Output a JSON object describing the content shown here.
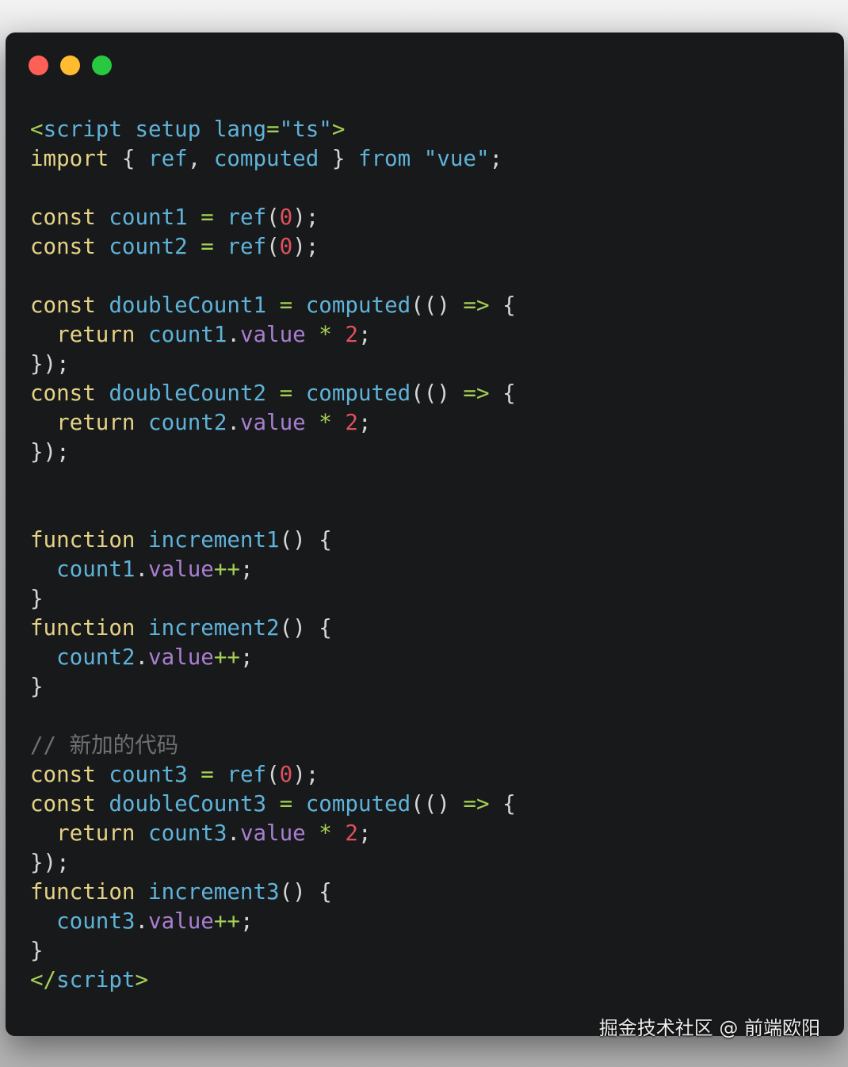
{
  "window": {
    "traffic_lights": [
      {
        "name": "close",
        "color": "#fe5f57"
      },
      {
        "name": "minimize",
        "color": "#febc2e"
      },
      {
        "name": "maximize",
        "color": "#28c840"
      }
    ]
  },
  "code": {
    "language": "vue-ts",
    "lines": [
      {
        "tokens": [
          [
            "tag",
            "<"
          ],
          [
            "id",
            "script"
          ],
          [
            "punc",
            " "
          ],
          [
            "id",
            "setup"
          ],
          [
            "punc",
            " "
          ],
          [
            "id",
            "lang"
          ],
          [
            "op",
            "="
          ],
          [
            "str",
            "\"ts\""
          ],
          [
            "tag",
            ">"
          ]
        ]
      },
      {
        "tokens": [
          [
            "kw",
            "import"
          ],
          [
            "punc",
            " { "
          ],
          [
            "id",
            "ref"
          ],
          [
            "punc",
            ", "
          ],
          [
            "id",
            "computed"
          ],
          [
            "punc",
            " } "
          ],
          [
            "id",
            "from"
          ],
          [
            "punc",
            " "
          ],
          [
            "str",
            "\"vue\""
          ],
          [
            "punc",
            ";"
          ]
        ]
      },
      {
        "tokens": []
      },
      {
        "tokens": [
          [
            "kw",
            "const"
          ],
          [
            "punc",
            " "
          ],
          [
            "id",
            "count1"
          ],
          [
            "punc",
            " "
          ],
          [
            "op",
            "="
          ],
          [
            "punc",
            " "
          ],
          [
            "id",
            "ref"
          ],
          [
            "punc",
            "("
          ],
          [
            "num",
            "0"
          ],
          [
            "punc",
            ");"
          ]
        ]
      },
      {
        "tokens": [
          [
            "kw",
            "const"
          ],
          [
            "punc",
            " "
          ],
          [
            "id",
            "count2"
          ],
          [
            "punc",
            " "
          ],
          [
            "op",
            "="
          ],
          [
            "punc",
            " "
          ],
          [
            "id",
            "ref"
          ],
          [
            "punc",
            "("
          ],
          [
            "num",
            "0"
          ],
          [
            "punc",
            ");"
          ]
        ]
      },
      {
        "tokens": []
      },
      {
        "tokens": [
          [
            "kw",
            "const"
          ],
          [
            "punc",
            " "
          ],
          [
            "id",
            "doubleCount1"
          ],
          [
            "punc",
            " "
          ],
          [
            "op",
            "="
          ],
          [
            "punc",
            " "
          ],
          [
            "id",
            "computed"
          ],
          [
            "punc",
            "(() "
          ],
          [
            "op",
            "=>"
          ],
          [
            "punc",
            " {"
          ]
        ]
      },
      {
        "tokens": [
          [
            "punc",
            "  "
          ],
          [
            "kw",
            "return"
          ],
          [
            "punc",
            " "
          ],
          [
            "id",
            "count1"
          ],
          [
            "punc",
            "."
          ],
          [
            "prop",
            "value"
          ],
          [
            "punc",
            " "
          ],
          [
            "op",
            "*"
          ],
          [
            "punc",
            " "
          ],
          [
            "num",
            "2"
          ],
          [
            "punc",
            ";"
          ]
        ]
      },
      {
        "tokens": [
          [
            "punc",
            "});"
          ]
        ]
      },
      {
        "tokens": [
          [
            "kw",
            "const"
          ],
          [
            "punc",
            " "
          ],
          [
            "id",
            "doubleCount2"
          ],
          [
            "punc",
            " "
          ],
          [
            "op",
            "="
          ],
          [
            "punc",
            " "
          ],
          [
            "id",
            "computed"
          ],
          [
            "punc",
            "(() "
          ],
          [
            "op",
            "=>"
          ],
          [
            "punc",
            " {"
          ]
        ]
      },
      {
        "tokens": [
          [
            "punc",
            "  "
          ],
          [
            "kw",
            "return"
          ],
          [
            "punc",
            " "
          ],
          [
            "id",
            "count2"
          ],
          [
            "punc",
            "."
          ],
          [
            "prop",
            "value"
          ],
          [
            "punc",
            " "
          ],
          [
            "op",
            "*"
          ],
          [
            "punc",
            " "
          ],
          [
            "num",
            "2"
          ],
          [
            "punc",
            ";"
          ]
        ]
      },
      {
        "tokens": [
          [
            "punc",
            "});"
          ]
        ]
      },
      {
        "tokens": []
      },
      {
        "tokens": []
      },
      {
        "tokens": [
          [
            "kw",
            "function"
          ],
          [
            "punc",
            " "
          ],
          [
            "id",
            "increment1"
          ],
          [
            "punc",
            "() {"
          ]
        ]
      },
      {
        "tokens": [
          [
            "punc",
            "  "
          ],
          [
            "id",
            "count1"
          ],
          [
            "punc",
            "."
          ],
          [
            "prop",
            "value"
          ],
          [
            "op",
            "++"
          ],
          [
            "punc",
            ";"
          ]
        ]
      },
      {
        "tokens": [
          [
            "punc",
            "}"
          ]
        ]
      },
      {
        "tokens": [
          [
            "kw",
            "function"
          ],
          [
            "punc",
            " "
          ],
          [
            "id",
            "increment2"
          ],
          [
            "punc",
            "() {"
          ]
        ]
      },
      {
        "tokens": [
          [
            "punc",
            "  "
          ],
          [
            "id",
            "count2"
          ],
          [
            "punc",
            "."
          ],
          [
            "prop",
            "value"
          ],
          [
            "op",
            "++"
          ],
          [
            "punc",
            ";"
          ]
        ]
      },
      {
        "tokens": [
          [
            "punc",
            "}"
          ]
        ]
      },
      {
        "tokens": []
      },
      {
        "tokens": [
          [
            "cmt",
            "// 新加的代码"
          ]
        ]
      },
      {
        "tokens": [
          [
            "kw",
            "const"
          ],
          [
            "punc",
            " "
          ],
          [
            "id",
            "count3"
          ],
          [
            "punc",
            " "
          ],
          [
            "op",
            "="
          ],
          [
            "punc",
            " "
          ],
          [
            "id",
            "ref"
          ],
          [
            "punc",
            "("
          ],
          [
            "num",
            "0"
          ],
          [
            "punc",
            ");"
          ]
        ]
      },
      {
        "tokens": [
          [
            "kw",
            "const"
          ],
          [
            "punc",
            " "
          ],
          [
            "id",
            "doubleCount3"
          ],
          [
            "punc",
            " "
          ],
          [
            "op",
            "="
          ],
          [
            "punc",
            " "
          ],
          [
            "id",
            "computed"
          ],
          [
            "punc",
            "(() "
          ],
          [
            "op",
            "=>"
          ],
          [
            "punc",
            " {"
          ]
        ]
      },
      {
        "tokens": [
          [
            "punc",
            "  "
          ],
          [
            "kw",
            "return"
          ],
          [
            "punc",
            " "
          ],
          [
            "id",
            "count3"
          ],
          [
            "punc",
            "."
          ],
          [
            "prop",
            "value"
          ],
          [
            "punc",
            " "
          ],
          [
            "op",
            "*"
          ],
          [
            "punc",
            " "
          ],
          [
            "num",
            "2"
          ],
          [
            "punc",
            ";"
          ]
        ]
      },
      {
        "tokens": [
          [
            "punc",
            "});"
          ]
        ]
      },
      {
        "tokens": [
          [
            "kw",
            "function"
          ],
          [
            "punc",
            " "
          ],
          [
            "id",
            "increment3"
          ],
          [
            "punc",
            "() {"
          ]
        ]
      },
      {
        "tokens": [
          [
            "punc",
            "  "
          ],
          [
            "id",
            "count3"
          ],
          [
            "punc",
            "."
          ],
          [
            "prop",
            "value"
          ],
          [
            "op",
            "++"
          ],
          [
            "punc",
            ";"
          ]
        ]
      },
      {
        "tokens": [
          [
            "punc",
            "}"
          ]
        ]
      },
      {
        "tokens": [
          [
            "tag",
            "</"
          ],
          [
            "id",
            "script"
          ],
          [
            "tag",
            ">"
          ]
        ]
      }
    ]
  },
  "watermark": "掘金技术社区 @ 前端欧阳"
}
